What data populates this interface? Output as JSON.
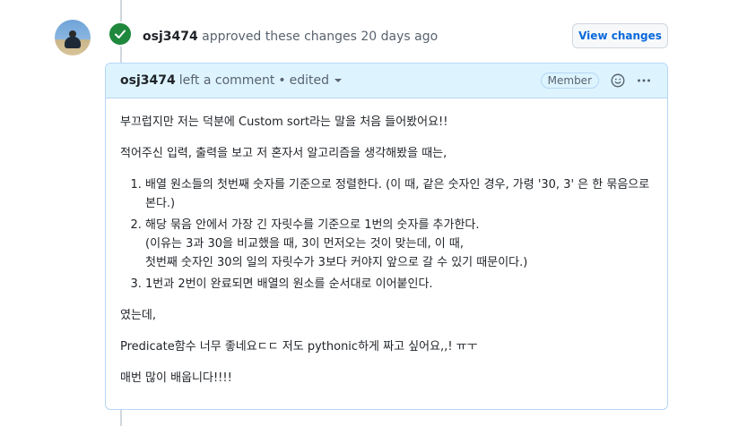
{
  "review": {
    "author": "osj3474",
    "action": "approved these changes",
    "time": "20 days ago",
    "view_changes_label": "View changes"
  },
  "comment": {
    "author": "osj3474",
    "meta": "left a comment",
    "separator": "•",
    "edited": "edited",
    "badge": "Member",
    "paragraphs": {
      "p1": "부끄럽지만 저는 덕분에 Custom sort라는 말을 처음 들어봤어요!!",
      "p2": "적어주신 입력, 출력을 보고 저 혼자서 알고리즘을 생각해봤을 때는,",
      "p3": "였는데,",
      "p4": "Predicate함수 너무 좋네요ㄷㄷ 저도 pythonic하게 짜고 싶어요,,! ㅠㅜ",
      "p5": "매번 많이 배웁니다!!!!"
    },
    "list": {
      "item1": {
        "line1": "배열 원소들의 첫번째 숫자를 기준으로 정렬한다. (이 때, 같은 숫자인 경우, 가령 '30, 3' 은 한 묶음으로",
        "line2": "본다.)"
      },
      "item2": {
        "line1": "해당 묶음 안에서 가장 긴 자릿수를 기준으로 1번의 숫자를 추가한다.",
        "line2": "(이유는 3과 30을 비교했을 때, 3이 먼저오는 것이 맞는데, 이 때,",
        "line3": "첫번째 숫자인 30의 일의 자릿수가 3보다 커야지 앞으로 갈 수 있기 때문이다.)"
      },
      "item3": {
        "line1": "1번과 2번이 완료되면 배열의 원소를 순서대로 이어붙인다."
      }
    }
  },
  "icons": {
    "approved": "check-icon",
    "emoji": "smiley-icon",
    "more": "kebab-horizontal-icon",
    "caret": "triangle-down-icon"
  },
  "colors": {
    "approved_green": "#1f883d",
    "link_blue": "#0969da",
    "header_bg": "#ddf4ff",
    "border_blue": "#b6d6f5"
  }
}
